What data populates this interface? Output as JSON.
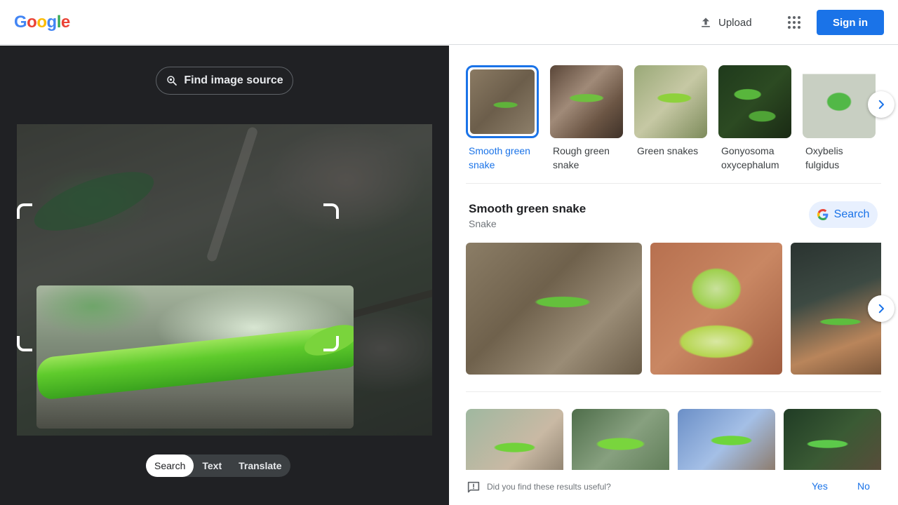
{
  "header": {
    "logo_letters": [
      {
        "char": "G",
        "color": "#4285F4"
      },
      {
        "char": "o",
        "color": "#EA4335"
      },
      {
        "char": "o",
        "color": "#FBBC05"
      },
      {
        "char": "g",
        "color": "#4285F4"
      },
      {
        "char": "l",
        "color": "#34A853"
      },
      {
        "char": "e",
        "color": "#EA4335"
      }
    ],
    "upload_label": "Upload",
    "upload_icon": "upload-icon",
    "apps_icon": "apps-grid-icon",
    "signin_label": "Sign in"
  },
  "left": {
    "find_source_label": "Find image source",
    "find_source_icon": "lens-search-icon",
    "mode_tabs": [
      {
        "label": "Search",
        "active": true
      },
      {
        "label": "Text",
        "active": false
      },
      {
        "label": "Translate",
        "active": false
      }
    ]
  },
  "right": {
    "related": [
      {
        "label": "Smooth green snake",
        "selected": true
      },
      {
        "label": "Rough green snake",
        "selected": false
      },
      {
        "label": "Green snakes",
        "selected": false
      },
      {
        "label": "Gonyosoma oxycephalum",
        "selected": false
      },
      {
        "label": "Oxybelis fulgidus",
        "selected": false
      }
    ],
    "entity": {
      "title": "Smooth green snake",
      "subtitle": "Snake",
      "search_label": "Search"
    },
    "feedback": {
      "question": "Did you find these results useful?",
      "yes": "Yes",
      "no": "No"
    }
  },
  "colors": {
    "accent": "#1a73e8",
    "dark_pane": "#202124",
    "chip_bg": "#e8f0fe"
  }
}
